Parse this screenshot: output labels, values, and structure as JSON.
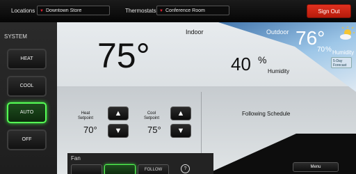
{
  "topbar": {
    "locations_label": "Locations",
    "location_value": "Downtown Store",
    "thermostats_label": "Thermostats",
    "thermostat_value": "Conference Room",
    "signout_label": "Sign Out"
  },
  "system": {
    "label": "SYSTEM",
    "modes": [
      "HEAT",
      "COOL",
      "AUTO",
      "OFF"
    ],
    "active_mode": "AUTO"
  },
  "indoor": {
    "label": "Indoor",
    "temperature": "75°",
    "humidity_value": "40",
    "humidity_unit": "%",
    "humidity_label": "Humidity"
  },
  "outdoor": {
    "label": "Outdoor",
    "temperature": "76°",
    "humidity_value": "70",
    "humidity_unit": "%",
    "humidity_label": "Humidity",
    "forecast_link": "5-Day\nForecast",
    "weather_icon": "sun-cloud-icon"
  },
  "setpoints": {
    "heat_label": "Heat\nSetpoint",
    "heat_value": "70°",
    "cool_label": "Cool\nSetpoint",
    "cool_value": "75°"
  },
  "schedule": {
    "status": "Following Schedule"
  },
  "fan": {
    "label": "Fan",
    "buttons": [
      "",
      "",
      "FOLLOW"
    ],
    "active_index": 1
  },
  "menu_label": "Menu",
  "colors": {
    "accent_green": "#55ff55",
    "signout_red": "#d9281a"
  }
}
